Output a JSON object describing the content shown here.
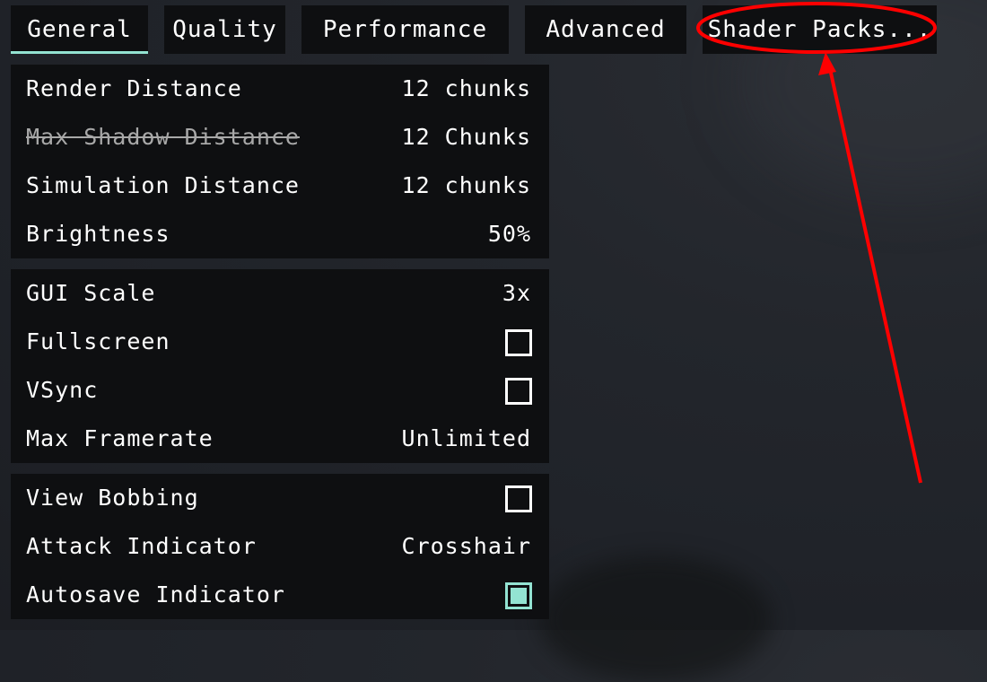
{
  "tabs": [
    {
      "label": "General",
      "active": true
    },
    {
      "label": "Quality",
      "active": false
    },
    {
      "label": "Performance",
      "active": false
    },
    {
      "label": "Advanced",
      "active": false
    },
    {
      "label": "Shader Packs...",
      "active": false
    }
  ],
  "groups": [
    {
      "rows": [
        {
          "label": "Render Distance",
          "value": "12 chunks",
          "type": "value"
        },
        {
          "label": "Max Shadow Distance",
          "value": "12 Chunks",
          "type": "value",
          "disabled": true
        },
        {
          "label": "Simulation Distance",
          "value": "12 chunks",
          "type": "value"
        },
        {
          "label": "Brightness",
          "value": "50%",
          "type": "value"
        }
      ]
    },
    {
      "rows": [
        {
          "label": "GUI Scale",
          "value": "3x",
          "type": "value"
        },
        {
          "label": "Fullscreen",
          "checked": false,
          "type": "checkbox"
        },
        {
          "label": "VSync",
          "checked": false,
          "type": "checkbox"
        },
        {
          "label": "Max Framerate",
          "value": "Unlimited",
          "type": "value"
        }
      ]
    },
    {
      "rows": [
        {
          "label": "View Bobbing",
          "checked": false,
          "type": "checkbox"
        },
        {
          "label": "Attack Indicator",
          "value": "Crosshair",
          "type": "value"
        },
        {
          "label": "Autosave Indicator",
          "checked": true,
          "type": "checkbox"
        }
      ]
    }
  ],
  "colors": {
    "accent": "#93e3d2",
    "panel": "#0e0f11",
    "annotation": "#ff0000"
  },
  "annotation": {
    "target": "Shader Packs...",
    "shape": "ellipse-with-arrow"
  }
}
